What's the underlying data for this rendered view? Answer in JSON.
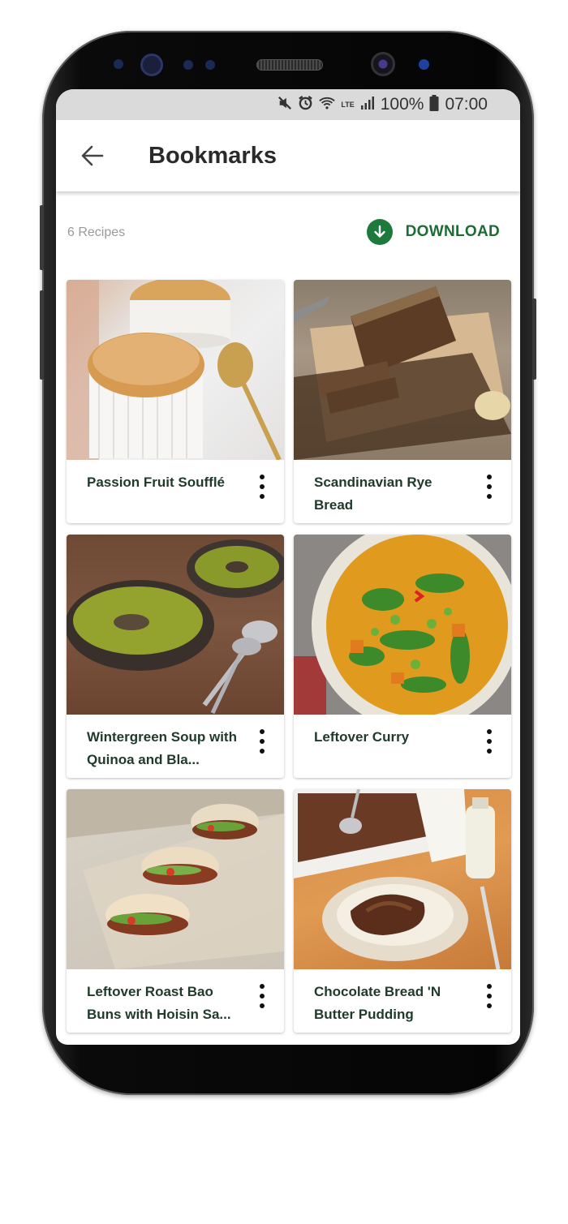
{
  "status_bar": {
    "battery": "100%",
    "time": "07:00",
    "network": "LTE",
    "icons": [
      "mute-icon",
      "alarm-icon",
      "wifi-icon",
      "signal-icon",
      "battery-icon"
    ]
  },
  "app_bar": {
    "title": "Bookmarks",
    "back_icon": "arrow-left-icon"
  },
  "toolbar": {
    "count": "6 Recipes",
    "download_label": "DOWNLOAD",
    "download_icon": "arrow-down-circle-icon"
  },
  "recipes": [
    {
      "title": "Passion Fruit Soufflé"
    },
    {
      "title": "Scandinavian Rye Bread"
    },
    {
      "title": "Wintergreen Soup with Quinoa and Bla..."
    },
    {
      "title": "Leftover Curry"
    },
    {
      "title": "Leftover Roast Bao Buns with Hoisin Sa..."
    },
    {
      "title": "Chocolate Bread 'N Butter Pudding"
    }
  ],
  "colors": {
    "accent": "#1e7a3c",
    "status_bar": "#d9dad9",
    "card_title": "#1f3a2a"
  }
}
